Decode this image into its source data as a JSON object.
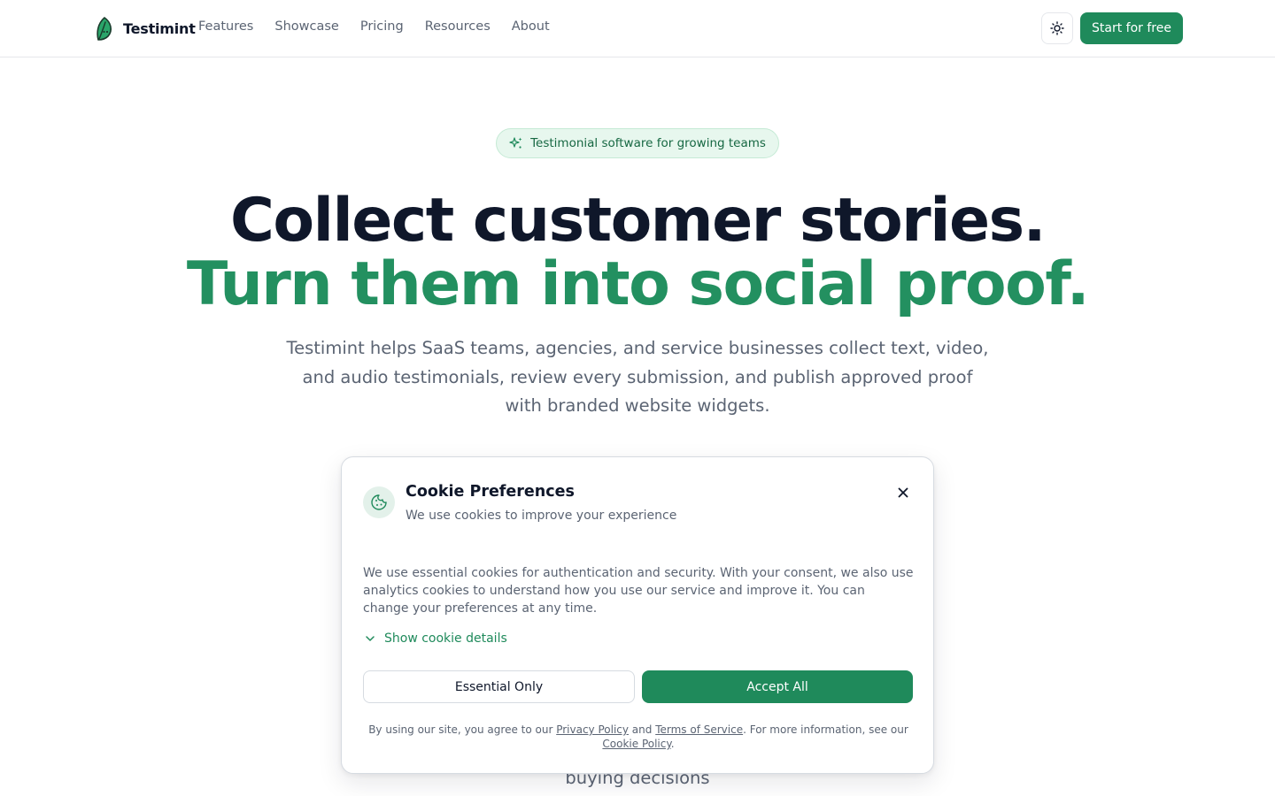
{
  "header": {
    "brand": "Testimint",
    "nav": [
      "Features",
      "Showcase",
      "Pricing",
      "Resources",
      "About"
    ],
    "cta": "Start for free",
    "icons": {
      "logo": "leaf-logo-icon",
      "theme": "sun-icon"
    }
  },
  "hero": {
    "badge": "Testimonial software for growing teams",
    "headline_1": "Collect customer stories.",
    "headline_2": "Turn them into social proof.",
    "subtitle": "Testimint helps SaaS teams, agencies, and service businesses collect text, video, and audio testimonials, review every submission, and publish approved proof with branded website widgets.",
    "partial_text": "buying decisions"
  },
  "cookie_dialog": {
    "title": "Cookie Preferences",
    "subtitle": "We use cookies to improve your experience",
    "body": "We use essential cookies for authentication and security. With your consent, we also use analytics cookies to understand how you use our service and improve it. You can change your preferences at any time.",
    "details_toggle": "Show cookie details",
    "essential_button": "Essential Only",
    "accept_button": "Accept All",
    "legal": {
      "prefix": "By using our site, you agree to our ",
      "privacy": "Privacy Policy",
      "and": " and ",
      "terms": "Terms of Service",
      "middle": ". For more information, see our ",
      "cookie_policy": "Cookie Policy",
      "suffix": "."
    }
  },
  "colors": {
    "brand_green": "#1f8a5b",
    "headline_dark": "#0f172a",
    "headline_green": "#239060",
    "muted_text": "#5b6473",
    "badge_bg": "#e7f7ee"
  }
}
